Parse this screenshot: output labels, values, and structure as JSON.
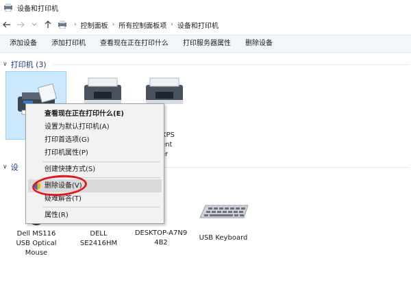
{
  "window": {
    "title": "设备和打印机"
  },
  "address": {
    "back_icon": "arrow-left",
    "forward_icon": "arrow-right",
    "up_icon": "arrow-up",
    "crumbs": [
      "控制面板",
      "所有控制面板项",
      "设备和打印机"
    ]
  },
  "toolbar": {
    "add_device": "添加设备",
    "add_printer": "添加打印机",
    "see_printing": "查看现在正在打印什么",
    "print_server_props": "打印服务器属性",
    "remove_device": "删除设备"
  },
  "printers_group": {
    "label": "打印机 (3)"
  },
  "printers": [
    {
      "label": "",
      "selected": true
    },
    {
      "label": ""
    },
    {
      "label_lines": [
        "ft XPS",
        "nent",
        "er"
      ]
    }
  ],
  "devices_group": {
    "label": "设"
  },
  "devices": [
    {
      "label_lines": [
        "Dell MS116",
        "USB Optical",
        "Mouse"
      ]
    },
    {
      "label_lines": [
        "DELL",
        "SE2416HM"
      ]
    },
    {
      "label_lines": [
        "DESKTOP-A7N9",
        "4B2"
      ]
    },
    {
      "label_lines": [
        "USB Keyboard"
      ]
    }
  ],
  "context_menu": {
    "items": [
      {
        "label": "查看现在正在打印什么(E)",
        "bold": true
      },
      {
        "label": "设置为默认打印机(A)"
      },
      {
        "label": "打印首选项(G)"
      },
      {
        "label": "打印机属性(P)"
      },
      {
        "label": "创建快捷方式(S)"
      },
      {
        "label": "删除设备(V)",
        "hover": true,
        "icon": "shield-icon"
      },
      {
        "label": "疑难解答(T)"
      },
      {
        "label": "属性(R)"
      }
    ]
  },
  "colors": {
    "accent": "#1e3287",
    "selection": "#cce8ff",
    "highlight": "#e0181b"
  }
}
